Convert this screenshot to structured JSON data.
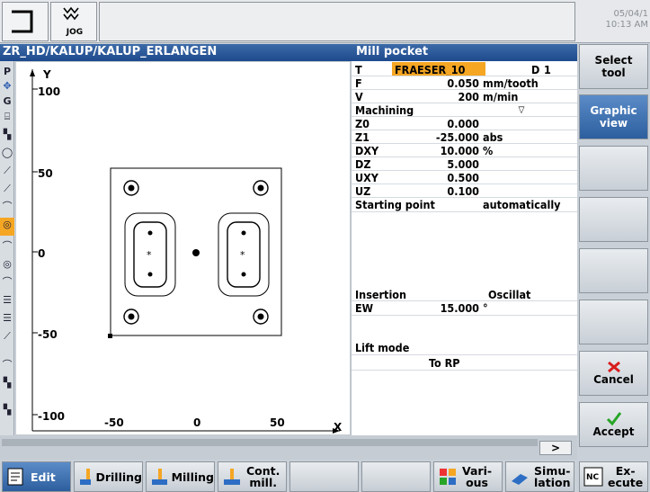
{
  "top": {
    "mode": "JOG",
    "datetime_date": "05/04/1",
    "datetime_time": "10:13 AM"
  },
  "title": {
    "path": "ZR_HD/KALUP/KALUP_ERLANGEN",
    "form": "Mill pocket"
  },
  "graphic": {
    "y_axis_label": "Y",
    "x_axis_label": "X",
    "y_ticks": [
      "100",
      "50",
      "0",
      "-50",
      "-100"
    ],
    "x_ticks": [
      "-50",
      "0",
      "50"
    ]
  },
  "tools": {
    "p_label": "P",
    "g_label": "G"
  },
  "params": {
    "t_label": "T",
    "t_value": "FRAESER_10",
    "d_label": "D",
    "d_value": "1",
    "f_label": "F",
    "f_value": "0.050",
    "f_unit": "mm/tooth",
    "v_label": "V",
    "v_value": "200",
    "v_unit": "m/min",
    "machining_label": "Machining",
    "machining_value": "▽",
    "z0_label": "Z0",
    "z0_value": "0.000",
    "z1_label": "Z1",
    "z1_value": "-25.000",
    "z1_unit": "abs",
    "dxy_label": "DXY",
    "dxy_value": "10.000",
    "dxy_unit": "%",
    "dz_label": "DZ",
    "dz_value": "5.000",
    "uxy_label": "UXY",
    "uxy_value": "0.500",
    "uz_label": "UZ",
    "uz_value": "0.100",
    "start_label": "Starting point",
    "start_value": "automatically",
    "insertion_label": "Insertion",
    "insertion_value": "Oscillat",
    "ew_label": "EW",
    "ew_value": "15.000",
    "ew_unit": "°",
    "lift_label": "Lift mode",
    "lift_value": "To RP"
  },
  "status": {
    "scroll_label": ">"
  },
  "right_softkeys": {
    "select_tool": "Select tool",
    "graphic_view": "Graphic view",
    "cancel": "Cancel",
    "accept": "Accept"
  },
  "bottom_softkeys": {
    "edit": "Edit",
    "drilling": "Drilling",
    "milling": "Milling",
    "cont_mill_1": "Cont.",
    "cont_mill_2": "mill.",
    "various_1": "Vari-",
    "various_2": "ous",
    "simulation_1": "Simu-",
    "simulation_2": "lation",
    "execute_1": "Ex-",
    "execute_2": "ecute",
    "nc_label": "NC"
  },
  "colors": {
    "accent": "#3c6aa8",
    "highlight": "#f5a623",
    "cancel_red": "#d81c1c",
    "accept_green": "#27a527"
  }
}
